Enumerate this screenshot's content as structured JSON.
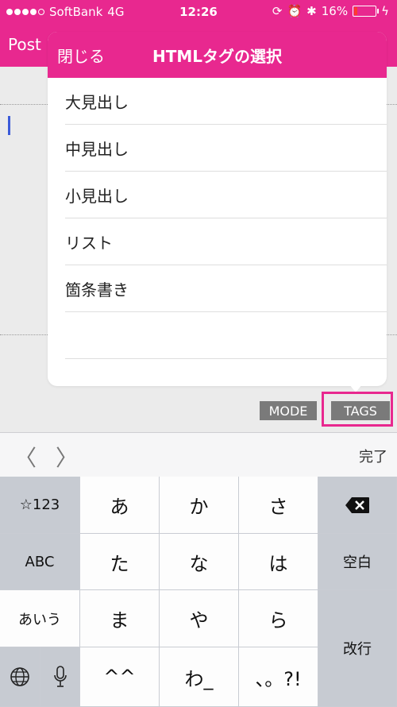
{
  "status": {
    "carrier": "SoftBank",
    "network": "4G",
    "time": "12:26",
    "battery_text": "16%",
    "battery_level": 0.16
  },
  "nav": {
    "title": "Post"
  },
  "popover": {
    "close_label": "閉じる",
    "title": "HTMLタグの選択",
    "items": [
      "大見出し",
      "中見出し",
      "小見出し",
      "リスト",
      "箇条書き"
    ]
  },
  "toolbar": {
    "mode_label": "MODE",
    "tags_label": "TAGS"
  },
  "accessory": {
    "back_label": "〈",
    "forward_label": "〉",
    "done_label": "完了"
  },
  "keyboard": {
    "numbers_label": "☆123",
    "abc_label": "ABC",
    "kana_mode_label": "あいう",
    "a": "あ",
    "ka": "か",
    "sa": "さ",
    "ta": "た",
    "na": "な",
    "ha": "は",
    "ma": "ま",
    "ya": "や",
    "ra": "ら",
    "emoticon": "^^",
    "wa": "わ_",
    "punct": "、。?!",
    "space_label": "空白",
    "return_label": "改行"
  },
  "colors": {
    "brand": "#e8288f",
    "highlight_box": "#e8288f"
  }
}
